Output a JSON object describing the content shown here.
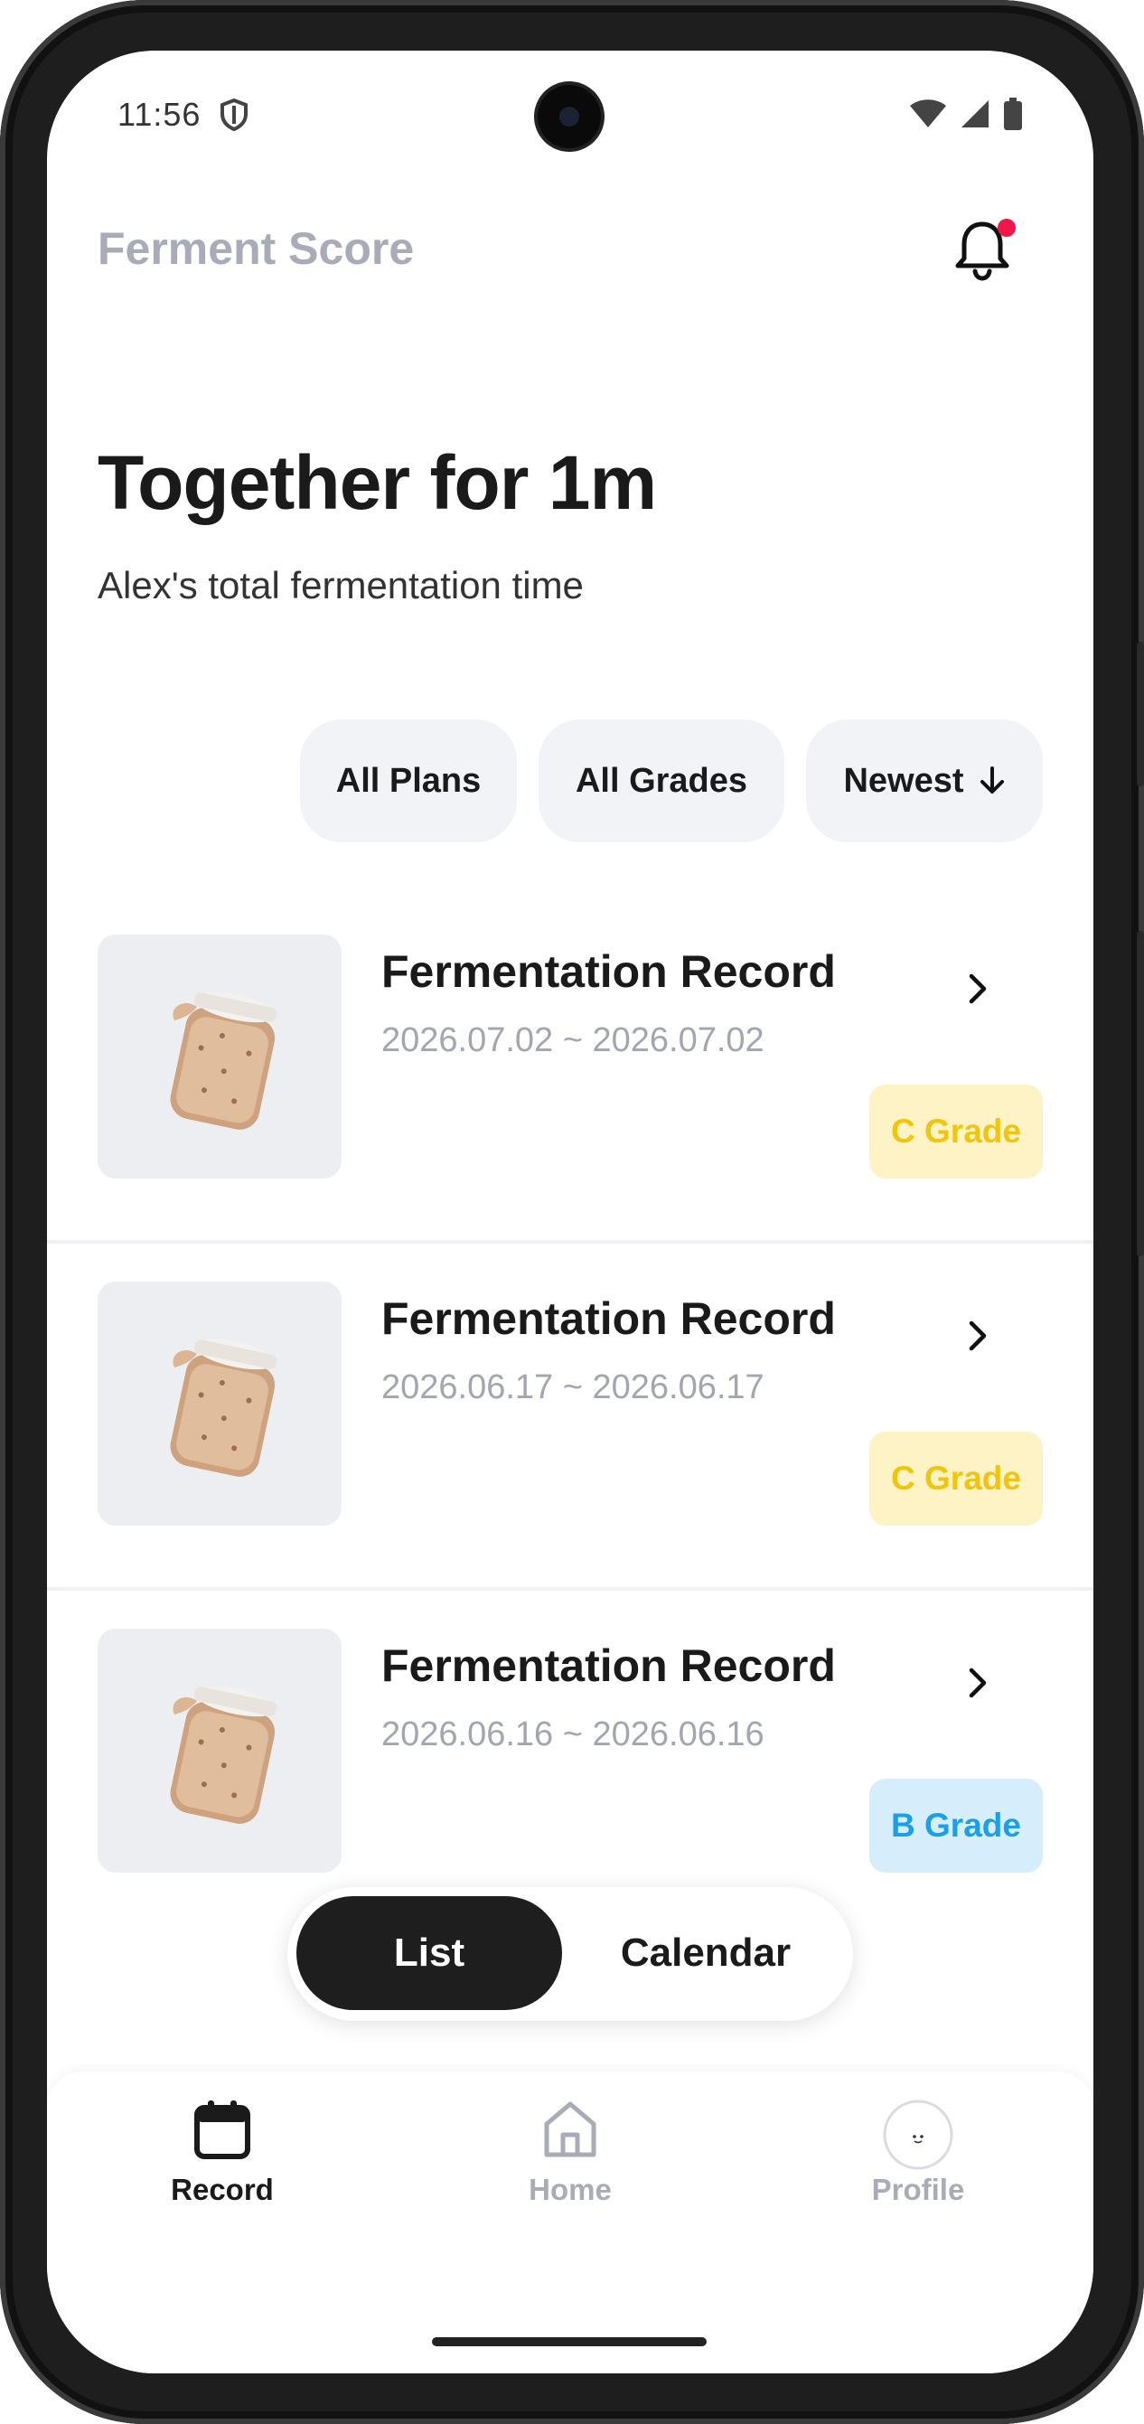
{
  "status_bar": {
    "time": "11:56"
  },
  "header": {
    "app_title": "Ferment Score"
  },
  "hero": {
    "title": "Together for 1m",
    "subtitle": "Alex's total fermentation time"
  },
  "filters": {
    "plans": "All Plans",
    "grades": "All Grades",
    "sort": "Newest"
  },
  "records": [
    {
      "title": "Fermentation Record",
      "date_range": "2026.07.02 ~ 2026.07.02",
      "grade": "C Grade",
      "grade_color": "#f1c50e",
      "grade_bg": "#fdf3c4"
    },
    {
      "title": "Fermentation Record",
      "date_range": "2026.06.17 ~ 2026.06.17",
      "grade": "C Grade",
      "grade_color": "#f1c50e",
      "grade_bg": "#fdf3c4"
    },
    {
      "title": "Fermentation Record",
      "date_range": "2026.06.16 ~ 2026.06.16",
      "grade": "B Grade",
      "grade_color": "#1aa0e8",
      "grade_bg": "#d6eefc"
    }
  ],
  "view_toggle": {
    "list": "List",
    "calendar": "Calendar",
    "active": "List"
  },
  "bottom_nav": {
    "record": "Record",
    "home": "Home",
    "profile": "Profile",
    "active": "Record"
  },
  "colors": {
    "accent_dark": "#1e1e1e",
    "muted": "#a9abb8",
    "notification_dot": "#f0174a"
  }
}
